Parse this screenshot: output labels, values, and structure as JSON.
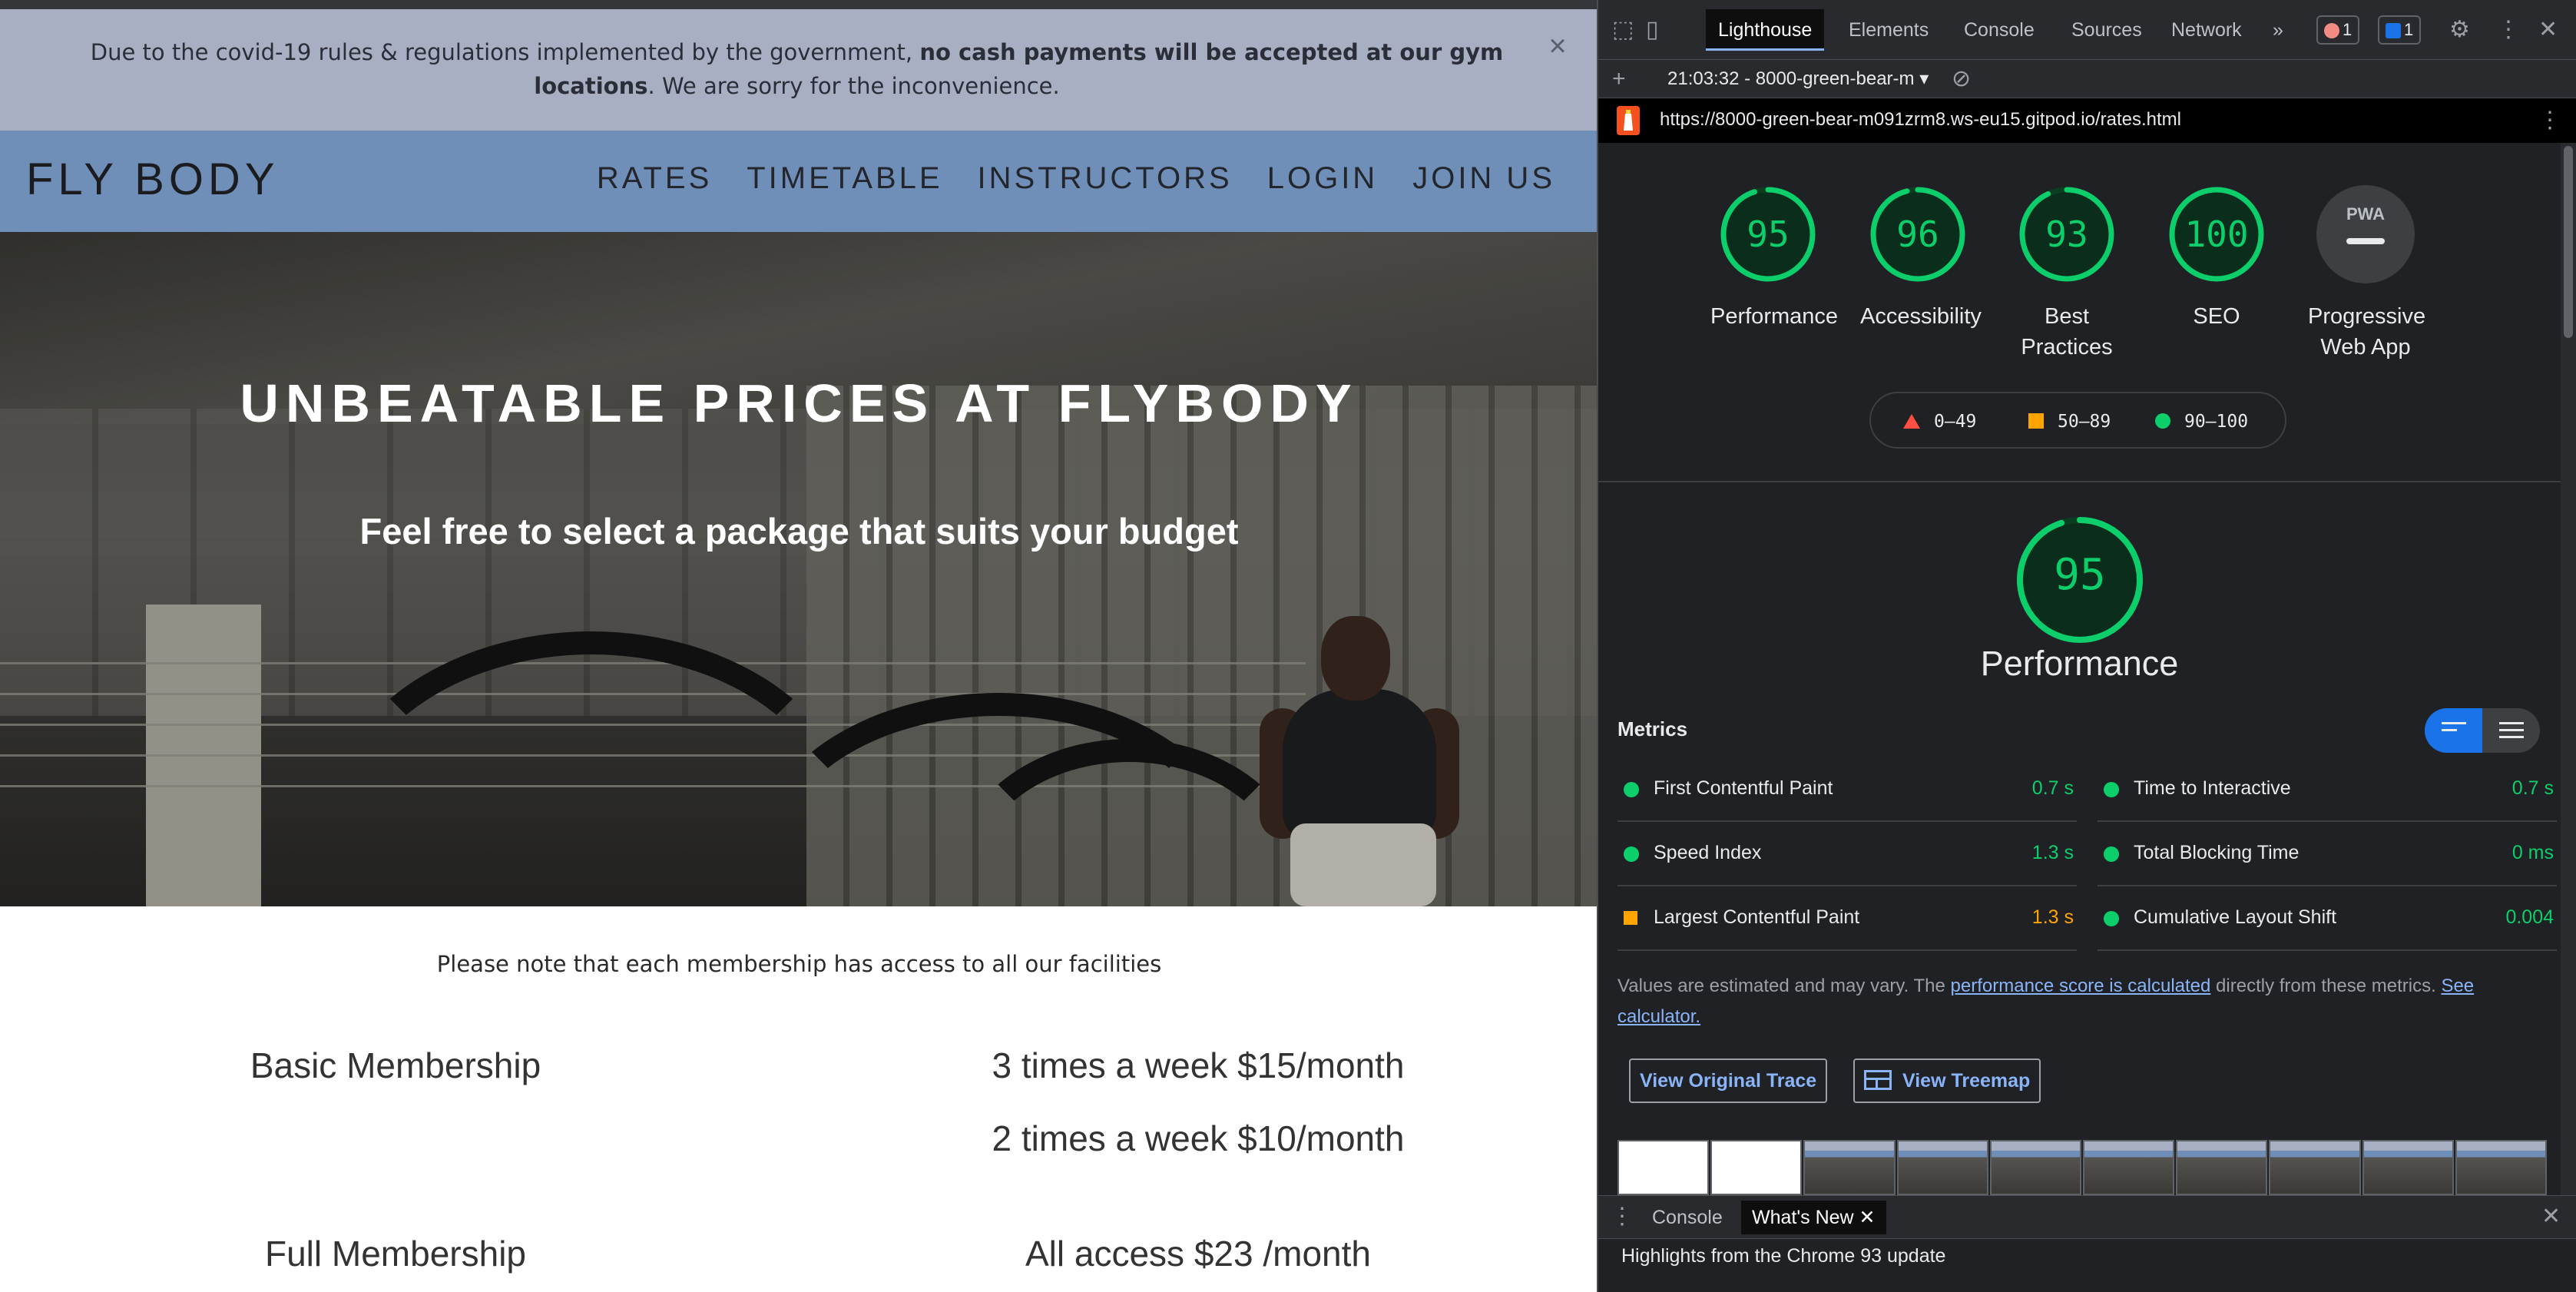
{
  "site": {
    "banner": {
      "text_before": "Due to the covid-19 rules & regulations implemented by the government,",
      "text_bold": "no cash payments will be accepted at our gym locations",
      "text_after": ". We are sorry for the inconvenience.",
      "close": "×"
    },
    "brand": "FLY BODY",
    "nav": [
      "RATES",
      "TIMETABLE",
      "INSTRUCTORS",
      "LOGIN",
      "JOIN US"
    ],
    "hero": {
      "title": "UNBEATABLE PRICES AT FLYBODY",
      "subtitle": "Feel free to select a package that suits your budget"
    },
    "note": "Please note that each membership has access to all our facilities",
    "rates": [
      {
        "name": "Basic Membership",
        "prices": [
          "3 times a week $15/month",
          "2 times a week $10/month"
        ]
      },
      {
        "name": "Full Membership",
        "prices": [
          "All access $23 /month"
        ]
      }
    ]
  },
  "devtools": {
    "tabs": [
      "Lighthouse",
      "Elements",
      "Console",
      "Sources",
      "Network"
    ],
    "active_tab": "Lighthouse",
    "more_tabs": "»",
    "error_count": "1",
    "message_count": "1",
    "session": "21:03:32 - 8000-green-bear-m",
    "url": "https://8000-green-bear-m091zrm8.ws-eu15.gitpod.io/rates.html",
    "scores": [
      {
        "score": "95",
        "label": "Performance"
      },
      {
        "score": "96",
        "label": "Accessibility"
      },
      {
        "score": "93",
        "label": "Best Practices"
      },
      {
        "score": "100",
        "label": "SEO"
      },
      {
        "score": "",
        "label": "Progressive Web App",
        "badge": "PWA"
      }
    ],
    "legend": [
      {
        "range": "0–49",
        "shape": "triangle",
        "color": "#ff4e42"
      },
      {
        "range": "50–89",
        "shape": "square",
        "color": "#ffa400"
      },
      {
        "range": "90–100",
        "shape": "circle",
        "color": "#0cce6b"
      }
    ],
    "performance": {
      "score": "95",
      "label": "Performance"
    },
    "metrics_title": "Metrics",
    "metrics": [
      {
        "name": "First Contentful Paint",
        "value": "0.7 s",
        "status": "pass"
      },
      {
        "name": "Time to Interactive",
        "value": "0.7 s",
        "status": "pass"
      },
      {
        "name": "Speed Index",
        "value": "1.3 s",
        "status": "pass"
      },
      {
        "name": "Total Blocking Time",
        "value": "0 ms",
        "status": "pass"
      },
      {
        "name": "Largest Contentful Paint",
        "value": "1.3 s",
        "status": "average"
      },
      {
        "name": "Cumulative Layout Shift",
        "value": "0.004",
        "status": "pass"
      }
    ],
    "estimate": {
      "before": "Values are estimated and may vary. The ",
      "link1": "performance score is calculated",
      "middle": " directly from these metrics. ",
      "link2": "See calculator."
    },
    "buttons": {
      "trace": "View Original Trace",
      "treemap": "View Treemap"
    },
    "drawer": {
      "tabs": [
        "Console",
        "What's New"
      ],
      "active": "What's New",
      "text": "Highlights from the Chrome 93 update"
    },
    "colors": {
      "pass": "#0cce6b",
      "average": "#ffa400",
      "fail": "#ff4e42",
      "accent": "#1a73e8"
    }
  }
}
